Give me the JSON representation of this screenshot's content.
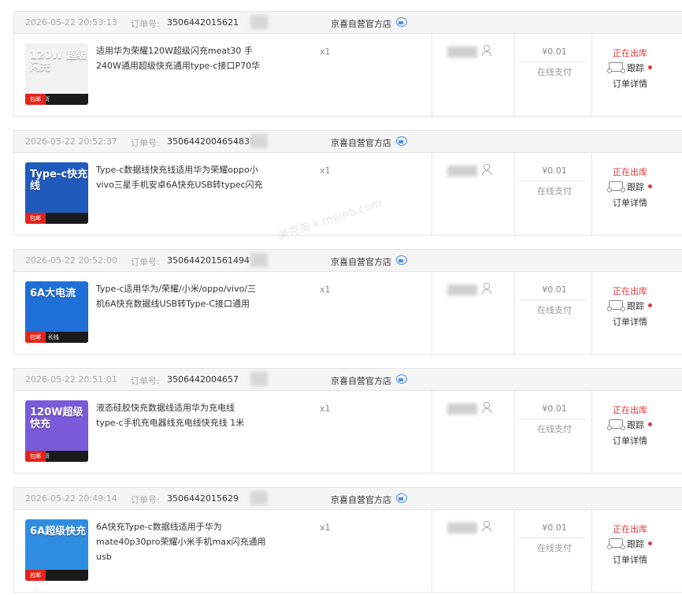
{
  "labels": {
    "order_no": "订单号:",
    "qty": "x1",
    "price": "¥0.01",
    "payment": "在线支付",
    "status": "正在出库",
    "track": "跟踪",
    "detail": "订单详情"
  },
  "orders": [
    {
      "date": "2026-05-22 20:53:13",
      "order_no": "3506442015621",
      "shop": "京喜自营官方店",
      "title1": "适用华为荣耀120W超级闪充meat30 手",
      "title2": "240W通用超级快充通用type-c接口P70华",
      "thumb_text": "120W 超级闪充",
      "thumb_badge": "包邮",
      "thumb_footer": "极速发货",
      "thumb_color": "#f1f1f1"
    },
    {
      "date": "2026-05-22 20:52:37",
      "order_no": "3506442004654837",
      "shop": "京喜自营官方店",
      "title1": "Type-c数据线快充线适用华为荣耀oppo小",
      "title2": "vivo三星手机安卓6A快充USB转typec闪充",
      "thumb_text": "Type-c快充线",
      "thumb_badge": "包邮",
      "thumb_footer": "",
      "thumb_color": "#1f5bbd"
    },
    {
      "date": "2026-05-22 20:52:00",
      "order_no": "350644201561494",
      "shop": "京喜自营官方店",
      "title1": "Type-c适用华为/荣耀/小米/oppo/vivo/三",
      "title2": "机6A快充数据线USB转Type-C接口通用",
      "thumb_text": "6A大电流",
      "thumb_badge": "包邮",
      "thumb_footer": "Type-C 长线",
      "thumb_color": "#1e6fd6"
    },
    {
      "date": "2026-05-22 20:51:01",
      "order_no": "3506442004657",
      "shop": "京喜自营官方店",
      "title1": "液态硅胶快充数据线适用华为充电线",
      "title2": "type-c手机充电器线充电线快充线 1米",
      "thumb_text": "120W超级快充",
      "thumb_badge": "包邮",
      "thumb_footer": "极速发货",
      "thumb_color": "#7a5ad8"
    },
    {
      "date": "2026-05-22 20:49:14",
      "order_no": "3506442015629",
      "shop": "京喜自营官方店",
      "title1": "6A快充Type-c数据线适用于华为",
      "title2": "mate40p30pro荣耀小米手机max闪充通用usb",
      "thumb_text": "6A超级快充",
      "thumb_badge": "包邮",
      "thumb_footer": "",
      "thumb_color": "#2f8de0"
    }
  ],
  "watermark": "美克淘 k.meinb.com"
}
